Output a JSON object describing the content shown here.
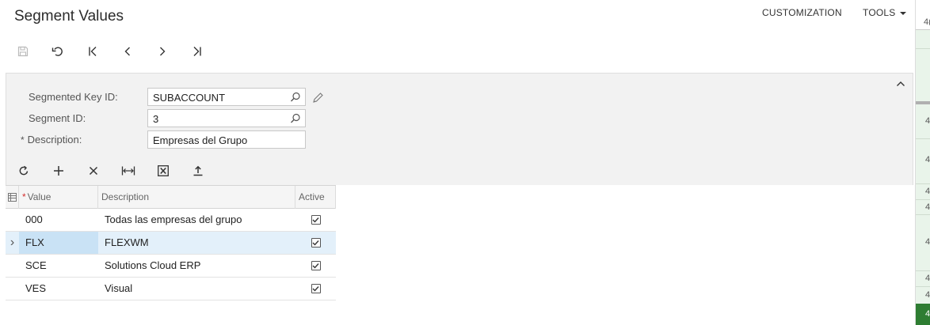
{
  "header": {
    "title": "Segment Values",
    "customization_label": "CUSTOMIZATION",
    "tools_label": "TOOLS"
  },
  "toolbar": {
    "icons": [
      "save-icon",
      "undo-icon",
      "first-icon",
      "previous-icon",
      "next-icon",
      "last-icon"
    ]
  },
  "form": {
    "segmented_key_label": "Segmented Key ID:",
    "segmented_key_value": "SUBACCOUNT",
    "segment_id_label": "Segment ID:",
    "segment_id_value": "3",
    "description_required": "*",
    "description_label": "Description:",
    "description_value": "Empresas del Grupo"
  },
  "grid_toolbar": {
    "icons": [
      "refresh-icon",
      "add-icon",
      "delete-icon",
      "fit-columns-icon",
      "export-excel-icon",
      "upload-icon"
    ]
  },
  "grid": {
    "columns": {
      "value_required": "*",
      "value": "Value",
      "description": "Description",
      "active": "Active"
    },
    "rows": [
      {
        "value": "000",
        "description": "Todas las empresas del grupo",
        "active": true
      },
      {
        "value": "FLX",
        "description": "FLEXWM",
        "active": true
      },
      {
        "value": "SCE",
        "description": "Solutions Cloud ERP",
        "active": true
      },
      {
        "value": "VES",
        "description": "Visual",
        "active": true
      }
    ],
    "selected_row_marker": "›"
  },
  "side_panel": {
    "values": [
      "4(",
      "4",
      "4",
      "4",
      "4",
      "4",
      "4",
      "4",
      "4"
    ]
  },
  "colors": {
    "accent_green": "#2e7d32",
    "selected_row": "#e3f0fa",
    "required_red": "#d32f2f"
  }
}
